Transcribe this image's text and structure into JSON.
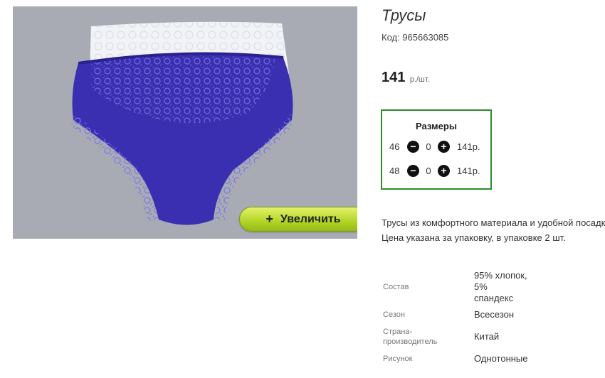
{
  "product": {
    "title": "Трусы",
    "code": "Код: 965663085",
    "price": "141",
    "price_unit": "р./шт.",
    "zoom_label": "Увеличить",
    "description": "Трусы из комфортного материала и удобной посадки. Цена указана за упаковку, в упаковке 2 шт."
  },
  "sizes": {
    "header": "Размеры",
    "rows": [
      {
        "size": "46",
        "qty": "0",
        "price": "141р."
      },
      {
        "size": "48",
        "qty": "0",
        "price": "141р."
      }
    ]
  },
  "specs": [
    {
      "label": "Состав",
      "value_lines": [
        "95% хлопок,",
        "5%",
        "спандекс"
      ]
    },
    {
      "label_lines": [
        "Страна-",
        "производитель"
      ],
      "label": "Сезон",
      "value": "Всесезон"
    },
    {
      "label_lines": [
        "Страна-",
        "производитель"
      ],
      "value": "Китай"
    },
    {
      "label": "Рисунок",
      "value": "Однотонные"
    }
  ],
  "colors": {
    "image_background": "#a9abb4",
    "sizes_border": "#2e8b2e",
    "zoom_button": "#b6d72b",
    "panty_blue": "#3a2fb0",
    "panty_white": "#f2f3f7"
  },
  "icons": {
    "minus": "minus-circle-icon",
    "plus": "plus-circle-icon",
    "zoom": "plus-icon"
  }
}
